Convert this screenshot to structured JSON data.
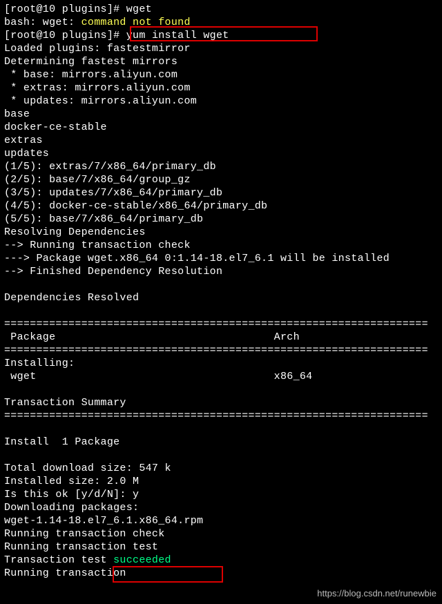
{
  "prompt1": "[root@10 plugins]# ",
  "cmd1": "wget",
  "bash_err_pre": "bash: wget: ",
  "bash_err_msg": "command not found",
  "prompt2": "[root@10 plugins]# ",
  "cmd2": "yum install wget",
  "lines1": [
    "Loaded plugins: fastestmirror",
    "Determining fastest mirrors",
    " * base: mirrors.aliyun.com",
    " * extras: mirrors.aliyun.com",
    " * updates: mirrors.aliyun.com",
    "base",
    "docker-ce-stable",
    "extras",
    "updates",
    "(1/5): extras/7/x86_64/primary_db",
    "(2/5): base/7/x86_64/group_gz",
    "(3/5): updates/7/x86_64/primary_db",
    "(4/5): docker-ce-stable/x86_64/primary_db",
    "(5/5): base/7/x86_64/primary_db",
    "Resolving Dependencies",
    "--> Running transaction check",
    "---> Package wget.x86_64 0:1.14-18.el7_6.1 will be installed",
    "--> Finished Dependency Resolution",
    "",
    "Dependencies Resolved",
    ""
  ],
  "sep": "==================================================================",
  "table_header": " Package                                  Arch",
  "install_hdr": "Installing:",
  "install_row": " wget                                     x86_64",
  "tx_summary": "Transaction Summary",
  "lines2": [
    "",
    "Install  1 Package",
    "",
    "Total download size: 547 k",
    "Installed size: 2.0 M",
    "Is this ok [y/d/N]: y",
    "Downloading packages:",
    "wget-1.14-18.el7_6.1.x86_64.rpm",
    "Running transaction check",
    "Running transaction test"
  ],
  "tx_test_pre": "Transaction test ",
  "tx_test_ok": "succeeded",
  "running_tx": "Running transaction",
  "watermark": "https://blog.csdn.net/runewbie"
}
